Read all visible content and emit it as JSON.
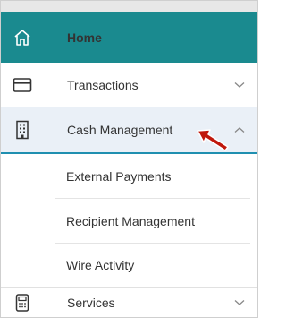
{
  "nav": {
    "home": {
      "label": "Home",
      "icon": "home-icon"
    },
    "transactions": {
      "label": "Transactions",
      "icon": "credit-card-icon"
    },
    "cash_management": {
      "label": "Cash Management",
      "icon": "building-icon",
      "expanded": true,
      "children": [
        {
          "label": "External Payments"
        },
        {
          "label": "Recipient Management"
        },
        {
          "label": "Wire Activity"
        }
      ]
    },
    "services": {
      "label": "Services",
      "icon": "calculator-icon"
    }
  },
  "colors": {
    "accent": "#1a8a8f",
    "active_background": "#eaf0f7",
    "active_border": "#1f8fb0",
    "annotation_arrow": "#c0180c"
  }
}
